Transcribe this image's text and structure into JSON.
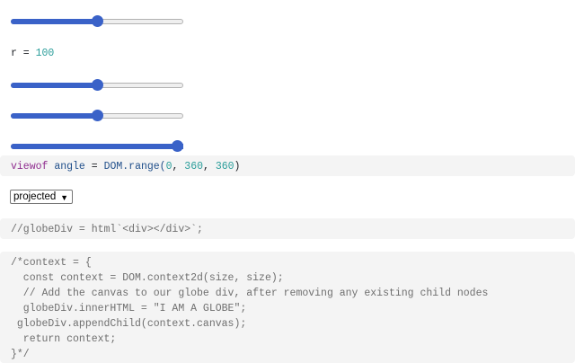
{
  "sliders": [
    {
      "name": "slider-1",
      "value_fraction": 0.5
    },
    {
      "name": "slider-2",
      "value_fraction": 0.5
    },
    {
      "name": "slider-3",
      "value_fraction": 0.5
    },
    {
      "name": "slider-4",
      "value_fraction": 1.0
    }
  ],
  "r_output": {
    "label": "r",
    "equals": " = ",
    "value": "100"
  },
  "angle_cell": {
    "keyword": "viewof",
    "variable": "angle",
    "equals": " = ",
    "call": "DOM.range(",
    "arg1": "0",
    "sep1": ", ",
    "arg2": "360",
    "sep2": ", ",
    "arg3": "360",
    "close": ")"
  },
  "projection_select": {
    "selected": "projected"
  },
  "globe_div_cell": {
    "line": "//globeDiv = html`<div></div>`;"
  },
  "context_cell": {
    "lines": [
      "/*context = {",
      "  const context = DOM.context2d(size, size);",
      "  // Add the canvas to our globe div, after removing any existing child nodes",
      "  globeDiv.innerHTML = \"I AM A GLOBE\";",
      " globeDiv.appendChild(context.canvas);",
      "  return context;",
      "}*/"
    ]
  },
  "colors": {
    "accent": "#3a62c8",
    "number": "#2a9d9a",
    "keyword": "#8f2d8f",
    "comment": "#6f6f6f",
    "cell_background": "#f4f4f4"
  }
}
